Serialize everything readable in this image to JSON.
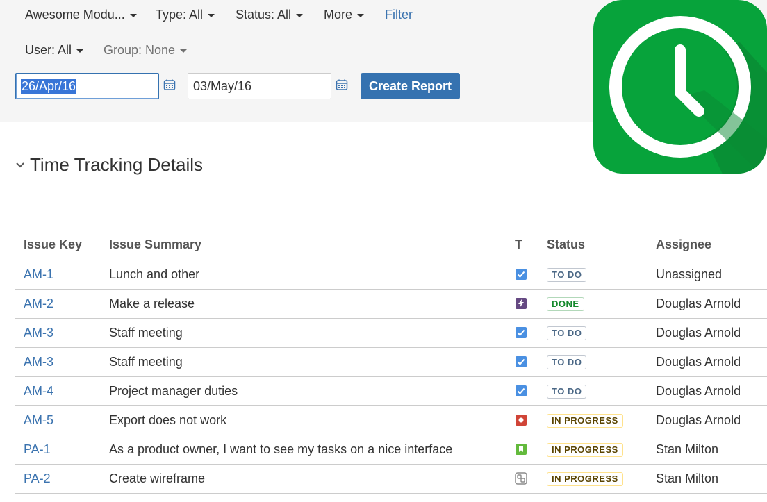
{
  "filters": {
    "module": "Awesome Modu...",
    "type": "Type: All",
    "status": "Status: All",
    "more": "More",
    "filter_link": "Filter",
    "user": "User: All",
    "group": "Group: None"
  },
  "report": {
    "start_date": "26/Apr/16",
    "end_date": "03/May/16",
    "create_label": "Create Report"
  },
  "section": {
    "title": "Time Tracking Details"
  },
  "table": {
    "headers": {
      "key": "Issue Key",
      "summary": "Issue Summary",
      "type": "T",
      "status": "Status",
      "assignee": "Assignee"
    },
    "rows": [
      {
        "key": "AM-1",
        "summary": "Lunch and other",
        "type_icon": "task-icon",
        "status": "TO DO",
        "assignee": "Unassigned"
      },
      {
        "key": "AM-2",
        "summary": "Make a release",
        "type_icon": "epic-icon",
        "status": "DONE",
        "assignee": "Douglas Arnold"
      },
      {
        "key": "AM-3",
        "summary": "Staff meeting",
        "type_icon": "task-icon",
        "status": "TO DO",
        "assignee": "Douglas Arnold"
      },
      {
        "key": "AM-3",
        "summary": "Staff meeting",
        "type_icon": "task-icon",
        "status": "TO DO",
        "assignee": "Douglas Arnold"
      },
      {
        "key": "AM-4",
        "summary": "Project manager duties",
        "type_icon": "task-icon",
        "status": "TO DO",
        "assignee": "Douglas Arnold"
      },
      {
        "key": "AM-5",
        "summary": "Export does not work",
        "type_icon": "bug-icon",
        "status": "IN PROGRESS",
        "assignee": "Douglas Arnold"
      },
      {
        "key": "PA-1",
        "summary": "As a product owner, I want to see my tasks on a nice interface",
        "type_icon": "story-icon",
        "status": "IN PROGRESS",
        "assignee": "Stan Milton"
      },
      {
        "key": "PA-2",
        "summary": "Create wireframe",
        "type_icon": "subtask-icon",
        "status": "IN PROGRESS",
        "assignee": "Stan Milton"
      }
    ]
  },
  "colors": {
    "link": "#3b73af",
    "primary_button": "#3572b0",
    "logo_green": "#07a33b",
    "todo": "#4a6785",
    "done": "#14892c",
    "in_progress": "#594300"
  }
}
